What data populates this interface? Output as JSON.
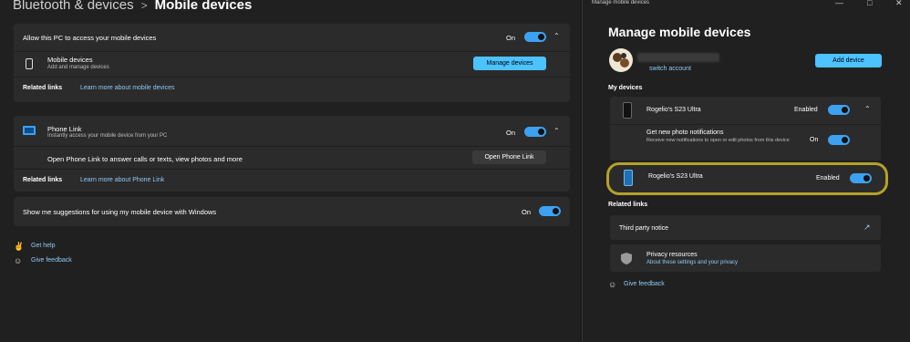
{
  "left": {
    "breadcrumb": {
      "parent": "Bluetooth & devices",
      "sep": ">",
      "current": "Mobile devices"
    },
    "access": {
      "label": "Allow this PC to access your mobile devices",
      "state": "On"
    },
    "mobile_devices": {
      "title": "Mobile devices",
      "sub": "Add and manage devices",
      "button": "Manage devices"
    },
    "related1": {
      "label": "Related links",
      "link": "Learn more about mobile devices"
    },
    "phone_link": {
      "title": "Phone Link",
      "sub": "Instantly access your mobile device from your PC",
      "state": "On"
    },
    "open_phone": {
      "label": "Open Phone Link to answer calls or texts, view photos and more",
      "button": "Open Phone Link"
    },
    "related2": {
      "label": "Related links",
      "link": "Learn more about Phone Link"
    },
    "suggestions": {
      "label": "Show me suggestions for using my mobile device with Windows",
      "state": "On"
    },
    "help": {
      "get_help": "Get help",
      "feedback": "Give feedback"
    }
  },
  "right": {
    "window_title": "Manage mobile devices",
    "heading": "Manage mobile devices",
    "switch_account": "switch account",
    "add_device": "Add device",
    "my_devices": "My devices",
    "device1": {
      "name": "Rogelio's S23 Ultra",
      "status": "Enabled"
    },
    "photo_notif": {
      "title": "Get new photo notifications",
      "sub": "Receive new notifications to open or edit photos from this device",
      "state": "On"
    },
    "device2": {
      "name": "Rogelio's S23 Ultra",
      "status": "Enabled"
    },
    "related_links": "Related links",
    "third_party": "Third party notice",
    "privacy": {
      "title": "Privacy resources",
      "link": "About these settings and your privacy"
    },
    "give_feedback": "Give feedback"
  },
  "colors": {
    "accent": "#4cc2ff",
    "toggle": "#3da1f2",
    "highlight": "#b4a12a",
    "card": "#2b2b2b",
    "bg": "#202020"
  }
}
